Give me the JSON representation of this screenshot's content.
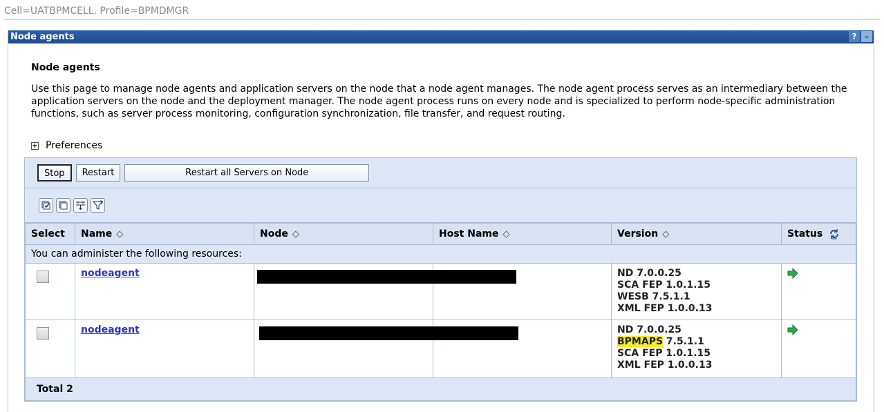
{
  "breadcrumb": "Cell=UATBPMCELL, Profile=BPMDMGR",
  "portlet": {
    "title": "Node agents",
    "help_icon": "?",
    "min_icon": "–"
  },
  "page": {
    "heading": "Node agents",
    "description": "Use this page to manage node agents and application servers on the node that a node agent manages. The node agent process serves as an intermediary between the application servers on the node and the deployment manager. The node agent process runs on every node and is specialized to perform node-specific administration functions, such as server process monitoring, configuration synchronization, file transfer, and request routing.",
    "preferences": "Preferences"
  },
  "toolbar": {
    "stop": "Stop",
    "restart": "Restart",
    "restart_all": "Restart all Servers on Node"
  },
  "icons": [
    "select-all-icon",
    "deselect-all-icon",
    "expand-filter-icon",
    "filter-icon"
  ],
  "table": {
    "headers": {
      "select": "Select",
      "name": "Name",
      "node": "Node",
      "host": "Host Name",
      "version": "Version",
      "status": "Status"
    },
    "sort_glyph": "◇",
    "info": "You can administer the following resources:",
    "rows": [
      {
        "name": "nodeagent",
        "node": "",
        "host": "",
        "version": [
          "ND 7.0.0.25",
          "SCA FEP 1.0.1.15",
          "WESB 7.5.1.1",
          "XML FEP 1.0.0.13"
        ],
        "status": "started"
      },
      {
        "name": "nodeagent",
        "node": "",
        "host": "",
        "version_highlight": "BPMAPS",
        "version": [
          "ND 7.0.0.25",
          " 7.5.1.1",
          "SCA FEP 1.0.1.15",
          "XML FEP 1.0.0.13"
        ],
        "status": "started"
      }
    ],
    "total": "Total 2"
  },
  "colors": {
    "titlebar": "#1d4d92",
    "grid_bg": "#dde6f4",
    "link": "#2b37c4",
    "highlight": "#f8ec2a",
    "status_green": "#2fa84f"
  }
}
